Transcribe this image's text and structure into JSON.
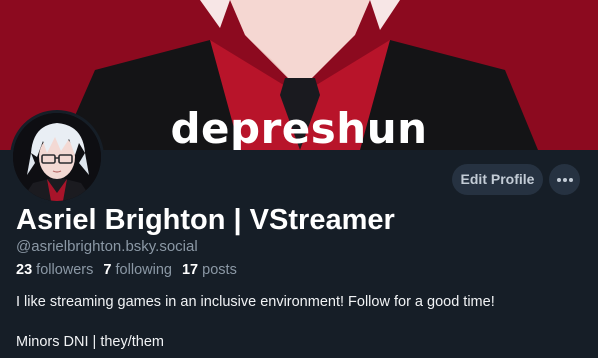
{
  "banner": {
    "text": "depreshun",
    "background": "#8c0a1f"
  },
  "profile": {
    "display_name": "Asriel Brighton | VStreamer",
    "handle": "@asrielbrighton.bsky.social",
    "stats": [
      {
        "count": "23",
        "label": "followers"
      },
      {
        "count": "7",
        "label": "following"
      },
      {
        "count": "17",
        "label": "posts"
      }
    ],
    "bio": [
      "I like streaming games in an inclusive environment! Follow for a good time!",
      "Minors DNI | they/them"
    ]
  },
  "actions": {
    "edit_label": "Edit Profile",
    "more_icon": "ellipsis-icon"
  },
  "colors": {
    "page_bg": "#161e27",
    "button_bg": "#263241",
    "muted_text": "#8b98a5"
  }
}
